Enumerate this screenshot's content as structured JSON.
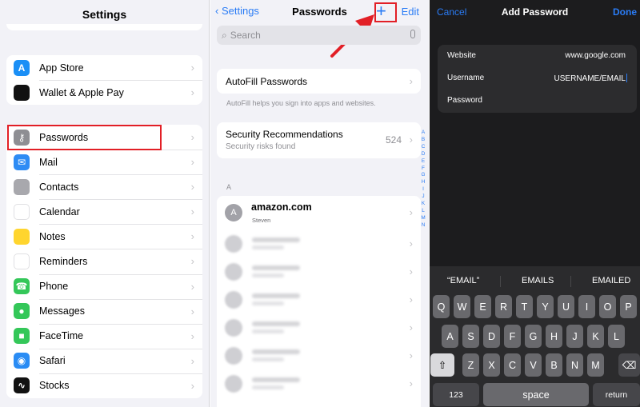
{
  "settings": {
    "title": "Settings",
    "group1": [
      {
        "label": "App Store",
        "icon": "app-store-icon",
        "color": "#1a8ff6"
      },
      {
        "label": "Wallet & Apple Pay",
        "icon": "wallet-icon",
        "color": "#111111"
      }
    ],
    "group2": [
      {
        "label": "Passwords",
        "icon": "key-icon",
        "color": "#8e8e93"
      },
      {
        "label": "Mail",
        "icon": "mail-icon",
        "color": "#2e8cf4"
      },
      {
        "label": "Contacts",
        "icon": "contacts-icon",
        "color": "#a8a8ad"
      },
      {
        "label": "Calendar",
        "icon": "calendar-icon",
        "color": "#ffffff"
      },
      {
        "label": "Notes",
        "icon": "notes-icon",
        "color": "#ffd52e"
      },
      {
        "label": "Reminders",
        "icon": "reminders-icon",
        "color": "#ffffff"
      },
      {
        "label": "Phone",
        "icon": "phone-icon",
        "color": "#34c759"
      },
      {
        "label": "Messages",
        "icon": "messages-icon",
        "color": "#34c759"
      },
      {
        "label": "FaceTime",
        "icon": "facetime-icon",
        "color": "#34c759"
      },
      {
        "label": "Safari",
        "icon": "safari-icon",
        "color": "#2a8cf4"
      },
      {
        "label": "Stocks",
        "icon": "stocks-icon",
        "color": "#111111"
      }
    ]
  },
  "passwords": {
    "back_label": "Settings",
    "title": "Passwords",
    "add_glyph": "+",
    "edit_label": "Edit",
    "search_placeholder": "Search",
    "autofill_label": "AutoFill Passwords",
    "autofill_desc": "AutoFill helps you sign into apps and websites.",
    "security_title": "Security Recommendations",
    "security_sub": "Security risks found",
    "security_count": "524",
    "section_letter": "A",
    "first_entry": {
      "avatar": "A",
      "site": "amazon.com",
      "user": "Steven"
    },
    "alphabet": [
      "A",
      "B",
      "C",
      "D",
      "E",
      "F",
      "G",
      "H",
      "I",
      "J",
      "K",
      "L",
      "M",
      "N"
    ]
  },
  "add_password": {
    "cancel_label": "Cancel",
    "title": "Add Password",
    "done_label": "Done",
    "website_label": "Website",
    "website_value": "www.google.com",
    "username_label": "Username",
    "username_value": "USERNAME/EMAIL",
    "password_label": "Password"
  },
  "keyboard": {
    "suggestions": [
      "“EMAIL”",
      "EMAILS",
      "EMAILED"
    ],
    "row1": [
      "Q",
      "W",
      "E",
      "R",
      "T",
      "Y",
      "U",
      "I",
      "O",
      "P"
    ],
    "row2": [
      "A",
      "S",
      "D",
      "F",
      "G",
      "H",
      "J",
      "K",
      "L"
    ],
    "row3": [
      "Z",
      "X",
      "C",
      "V",
      "B",
      "N",
      "M"
    ],
    "numbers_label": "123",
    "space_label": "space",
    "return_label": "return"
  },
  "colors": {
    "accent": "#2a7cf6",
    "highlight": "#e21f26"
  }
}
